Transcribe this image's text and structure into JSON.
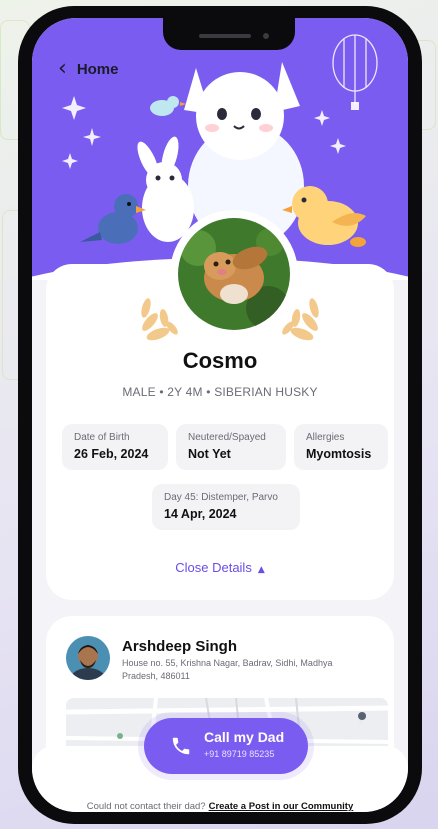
{
  "nav": {
    "back_label": "Home"
  },
  "pet": {
    "name": "Cosmo",
    "meta": "MALE  •  2Y 4M  •  SIBERIAN HUSKY",
    "details": [
      {
        "key": "Date of Birth",
        "value": "26 Feb, 2024"
      },
      {
        "key": "Neutered/Spayed",
        "value": "Not Yet"
      },
      {
        "key": "Allergies",
        "value": "Myomtosis"
      },
      {
        "key": "Day 45: Distemper, Parvo",
        "value": "14 Apr, 2024"
      }
    ],
    "close_details_label": "Close Details"
  },
  "owner": {
    "name": "Arshdeep Singh",
    "address": "House no. 55, Krishna Nagar, Badrav, Sidhi, Madhya Pradesh, 486011"
  },
  "call": {
    "label": "Call my Dad",
    "number": "+91 89719 85235"
  },
  "footer": {
    "prompt": "Could not contact their dad?",
    "link": "Create a Post in our Community"
  },
  "colors": {
    "accent": "#7a5cf0",
    "laurel": "#f2c98a"
  }
}
